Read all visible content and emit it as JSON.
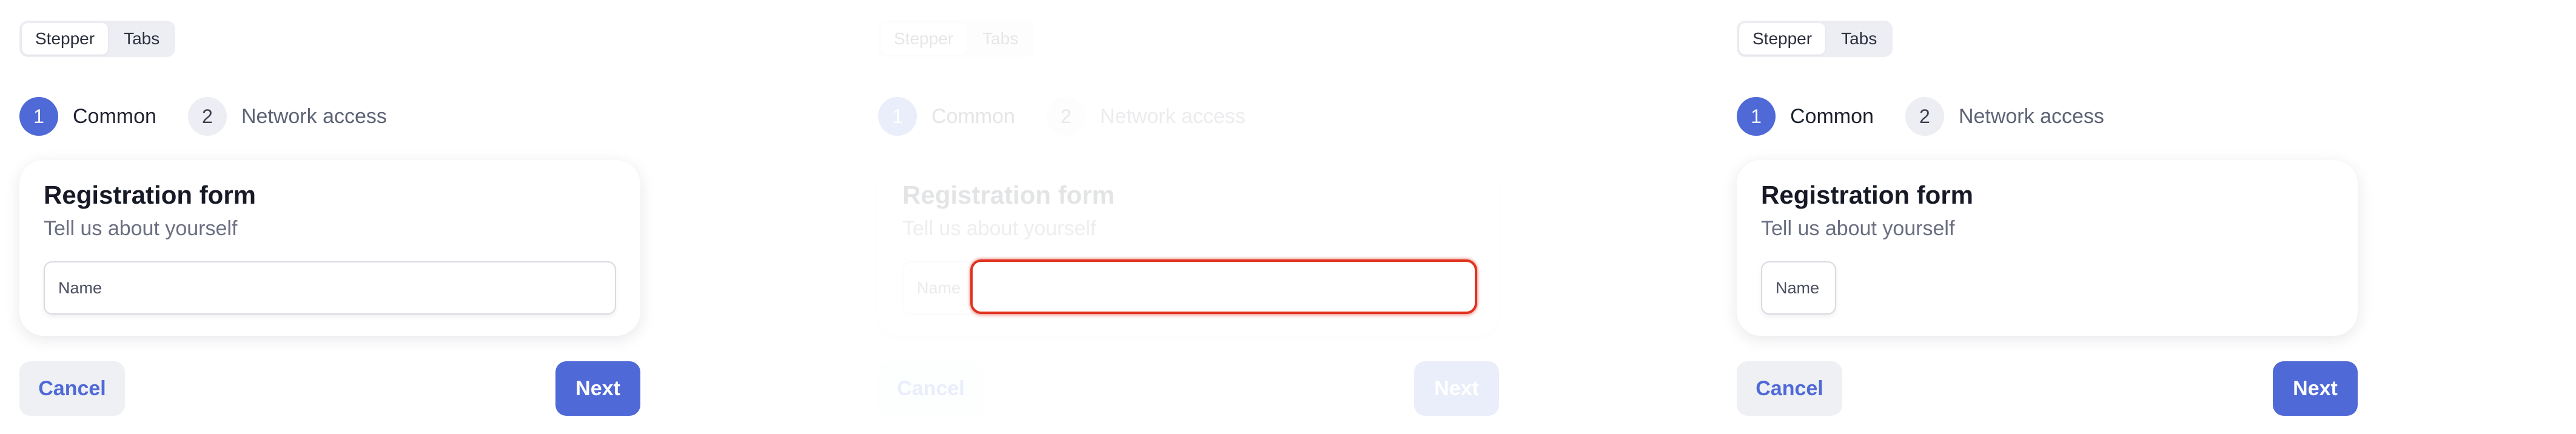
{
  "switcher": {
    "stepper_label": "Stepper",
    "tabs_label": "Tabs"
  },
  "steps": [
    {
      "number": "1",
      "label": "Common"
    },
    {
      "number": "2",
      "label": "Network access"
    }
  ],
  "form": {
    "title": "Registration form",
    "subtitle": "Tell us about yourself",
    "name_field_label": "Name"
  },
  "buttons": {
    "cancel_label": "Cancel",
    "next_label": "Next"
  },
  "colors": {
    "accent": "#4f69d6",
    "focus_error": "#e0321e"
  }
}
